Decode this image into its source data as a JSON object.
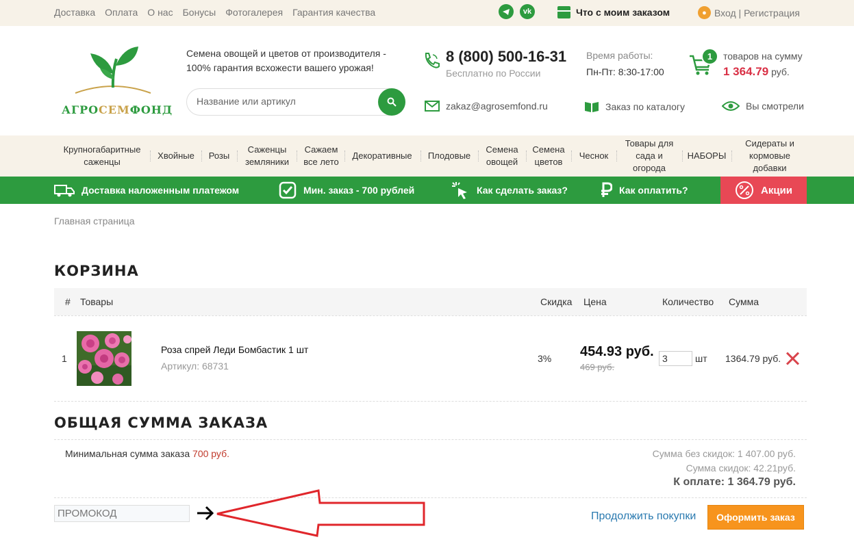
{
  "topbar": {
    "nav": [
      "Доставка",
      "Оплата",
      "О нас",
      "Бонусы",
      "Фотогалерея",
      "Гарантия качества"
    ],
    "track_label": "Что с моим заказом",
    "login_label": "Вход | Регистрация"
  },
  "header": {
    "logo_parts": [
      "АГРО",
      "СЕМ",
      "ФОНД"
    ],
    "slogan_line1": "Семена овощей и цветов от производителя -",
    "slogan_line2": "100% гарантия всхожести вашего урожая!",
    "search_placeholder": "Название или артикул",
    "phone": "8 (800) 500-16-31",
    "phone_note": "Бесплатно по России",
    "hours_label": "Время работы:",
    "hours": "Пн-Пт: 8:30-17:00",
    "cart_count": "1",
    "cart_label": "товаров на сумму",
    "cart_sum": "1 364.79",
    "cart_currency": "руб.",
    "email": "zakaz@agrosemfond.ru",
    "catalog_order": "Заказ по каталогу",
    "viewed": "Вы смотрели"
  },
  "categories": [
    "Крупногабаритные саженцы",
    "Хвойные",
    "Розы",
    "Саженцы земляники",
    "Сажаем все лето",
    "Декоративные",
    "Плодовые",
    "Семена овощей",
    "Семена цветов",
    "Чеснок",
    "Товары для сада и огорода",
    "НАБОРЫ",
    "Сидераты и кормовые добавки"
  ],
  "greenbar": {
    "delivery": "Доставка наложенным платежом",
    "min_order": "Мин. заказ - 700 рублей",
    "how_to_order": "Как сделать заказ?",
    "how_to_pay": "Как оплатить?",
    "sales": "Акции"
  },
  "breadcrumb": "Главная страница",
  "cart": {
    "title": "КОРЗИНА",
    "columns": {
      "num": "#",
      "goods": "Товары",
      "discount": "Скидка",
      "price": "Цена",
      "qty": "Количество",
      "sum": "Сумма"
    },
    "items": [
      {
        "num": "1",
        "name": "Роза спрей Леди Бомбастик 1 шт",
        "article": "Артикул: 68731",
        "discount": "3%",
        "price": "454.93 руб.",
        "old_price": "469 руб.",
        "qty": "3",
        "unit": "шт",
        "sum": "1364.79 руб."
      }
    ]
  },
  "totals": {
    "title": "ОБЩАЯ СУММА ЗАКАЗА",
    "min_label": "Минимальная сумма заказа",
    "min_value": "700 руб.",
    "without_discount": "Сумма без скидок: 1 407.00 руб.",
    "discount_sum": "Сумма скидок: 42.21руб.",
    "to_pay": "К оплате: 1 364.79 руб."
  },
  "footer_actions": {
    "promo_placeholder": "ПРОМОКОД",
    "continue": "Продолжить покупки",
    "checkout": "Оформить заказ"
  },
  "colors": {
    "brand_green": "#2d9b3f",
    "accent_red": "#e84855",
    "checkout_orange": "#f7941d",
    "link_blue": "#2a7ab0"
  }
}
